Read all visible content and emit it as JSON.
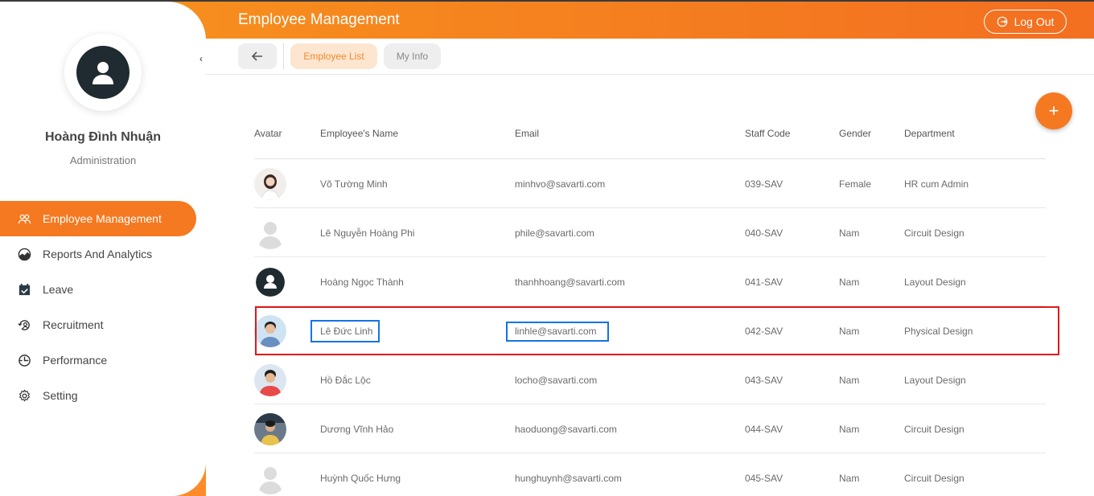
{
  "header": {
    "title": "Employee Management",
    "logout_label": "Log Out"
  },
  "sidebar": {
    "user_name": "Hoàng Đình Nhuận",
    "user_role": "Administration",
    "items": [
      {
        "label": "Employee Management",
        "icon": "users-icon",
        "active": true
      },
      {
        "label": "Reports And Analytics",
        "icon": "analytics-icon"
      },
      {
        "label": "Leave",
        "icon": "calendar-check-icon"
      },
      {
        "label": "Recruitment",
        "icon": "recruitment-icon"
      },
      {
        "label": "Performance",
        "icon": "performance-icon"
      },
      {
        "label": "Setting",
        "icon": "gear-icon"
      }
    ]
  },
  "subnav": {
    "tabs": [
      {
        "label": "Employee List",
        "active": true
      },
      {
        "label": "My Info"
      }
    ]
  },
  "table": {
    "headers": [
      "Avatar",
      "Employee's Name",
      "Email",
      "Staff Code",
      "Gender",
      "Department"
    ],
    "rows": [
      {
        "name": "Võ Tường Minh",
        "email": "minhvo@savarti.com",
        "code": "039-SAV",
        "gender": "Female",
        "dept": "HR cum Admin"
      },
      {
        "name": "Lê Nguyễn Hoàng Phi",
        "email": "phile@savarti.com",
        "code": "040-SAV",
        "gender": "Nam",
        "dept": "Circuit Design"
      },
      {
        "name": "Hoàng Ngọc Thành",
        "email": "thanhhoang@savarti.com",
        "code": "041-SAV",
        "gender": "Nam",
        "dept": "Layout Design"
      },
      {
        "name": "Lê Đức Linh",
        "email": "linhle@savarti.com",
        "code": "042-SAV",
        "gender": "Nam",
        "dept": "Physical Design"
      },
      {
        "name": "Hồ Đắc Lộc",
        "email": "locho@savarti.com",
        "code": "043-SAV",
        "gender": "Nam",
        "dept": "Layout Design"
      },
      {
        "name": "Dương Vĩnh Hảo",
        "email": "haoduong@savarti.com",
        "code": "044-SAV",
        "gender": "Nam",
        "dept": "Circuit Design"
      },
      {
        "name": "Huỳnh Quốc Hưng",
        "email": "hunghuynh@savarti.com",
        "code": "045-SAV",
        "gender": "Nam",
        "dept": "Circuit Design"
      }
    ]
  },
  "colors": {
    "accent": "#f47920",
    "highlight_row": "#e01818",
    "highlight_cell": "#1473e6"
  }
}
